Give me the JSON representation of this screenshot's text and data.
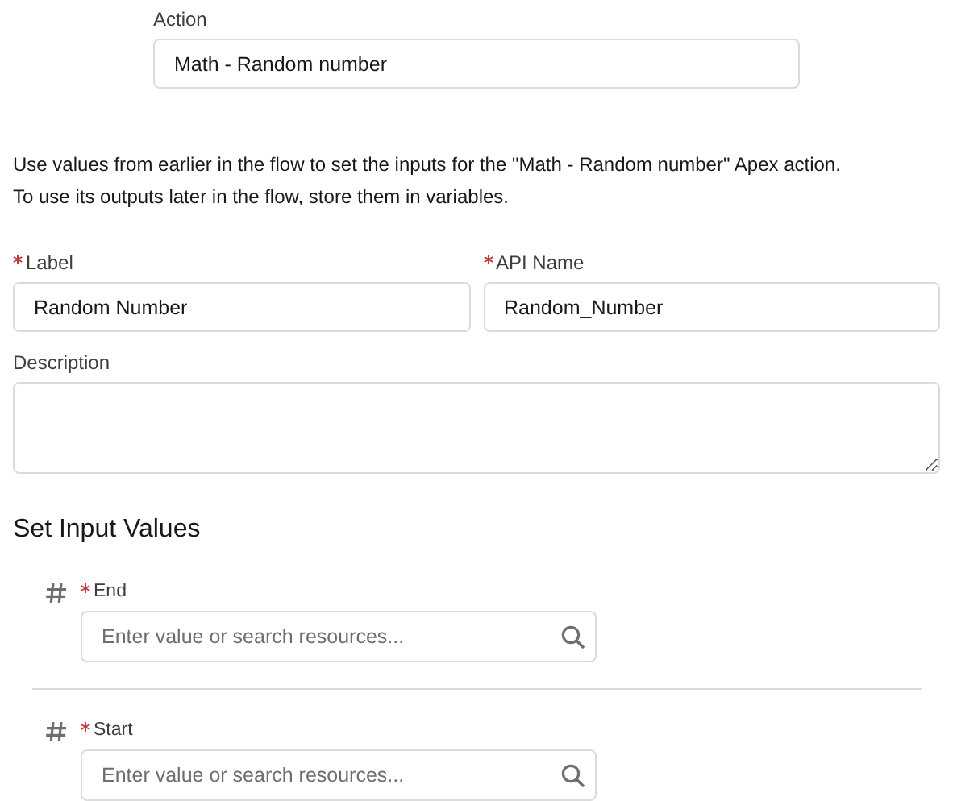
{
  "action": {
    "label": "Action",
    "value": "Math - Random number"
  },
  "intro": [
    "Use values from earlier in the flow to set the inputs for the \"Math - Random number\" Apex action.",
    "To use its outputs later in the flow, store them in variables."
  ],
  "fields": [
    {
      "label": "Label",
      "required": true,
      "value": "Random Number"
    },
    {
      "label": "API Name",
      "required": true,
      "value": "Random_Number"
    }
  ],
  "description": {
    "label": "Description",
    "required": false
  },
  "inputs_heading": "Set Input Values",
  "inputs": [
    {
      "label": "End",
      "required": true,
      "placeholder": "Enter value or search resources..."
    },
    {
      "label": "Start",
      "required": true,
      "placeholder": "Enter value or search resources..."
    }
  ]
}
